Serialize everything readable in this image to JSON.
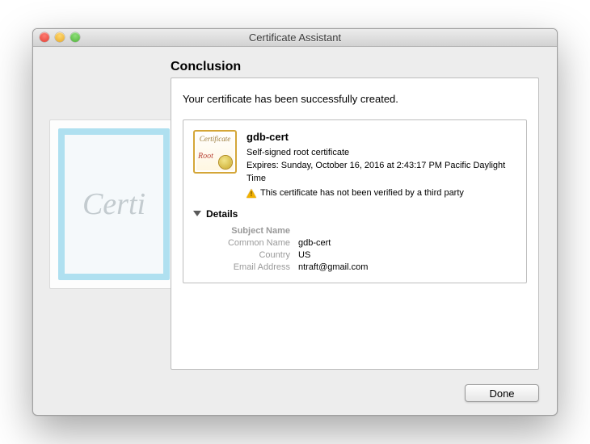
{
  "window": {
    "title": "Certificate Assistant"
  },
  "page": {
    "heading": "Conclusion",
    "success_message": "Your certificate has been successfully created."
  },
  "certificate": {
    "name": "gdb-cert",
    "type": "Self-signed root certificate",
    "expiry": "Expires: Sunday, October 16, 2016 at 2:43:17 PM Pacific Daylight Time",
    "warning": "This certificate has not been verified by a third party",
    "icon_root_label": "Root"
  },
  "details": {
    "toggle_label": "Details",
    "subject_header": "Subject Name",
    "rows": [
      {
        "key": "Common Name",
        "value": "gdb-cert"
      },
      {
        "key": "Country",
        "value": "US"
      },
      {
        "key": "Email Address",
        "value": "ntraft@gmail.com"
      }
    ]
  },
  "footer": {
    "done_label": "Done"
  }
}
